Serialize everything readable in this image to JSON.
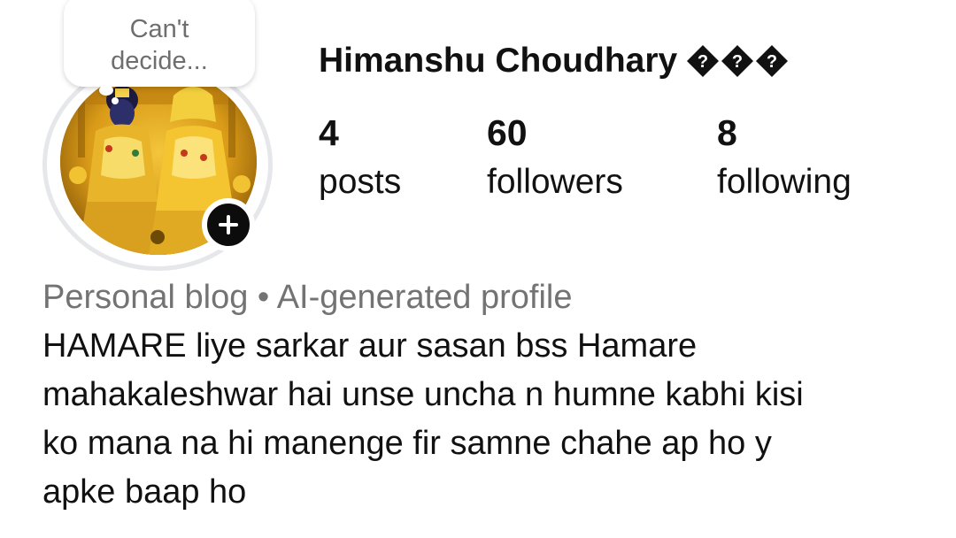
{
  "note": {
    "lines": [
      "Can't",
      "decide..."
    ]
  },
  "profile": {
    "name": "Himanshu Choudhary",
    "name_badges": [
      "replacement-char-icon",
      "replacement-char-icon",
      "replacement-char-icon"
    ],
    "avatar_description_icon": "profile-photo",
    "add_story_icon": "plus-icon"
  },
  "stats": {
    "posts": {
      "value": "4",
      "label": "posts"
    },
    "followers": {
      "value": "60",
      "label": "followers"
    },
    "following": {
      "value": "8",
      "label": "following"
    }
  },
  "bio": {
    "category": "Personal blog • AI-generated profile",
    "lines": [
      "HAMARE liye sarkar aur sasan bss Hamare",
      "mahakaleshwar hai unse uncha n humne kabhi kisi",
      "ko mana na hi manenge fir samne chahe ap ho y",
      "apke baap ho"
    ]
  },
  "colors": {
    "text_primary": "#111111",
    "text_secondary": "#737373",
    "avatar_ring": "#e6e7ea",
    "add_button": "#0c0c0c"
  }
}
